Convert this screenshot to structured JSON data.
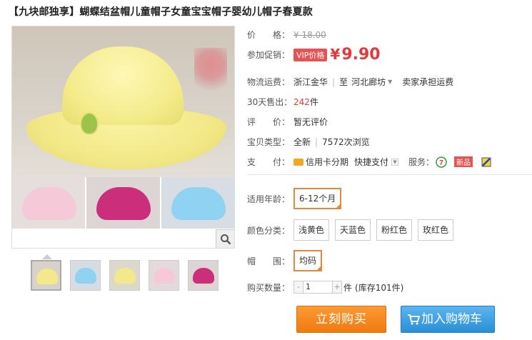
{
  "title": "【九块邮独享】蝴蝶结盆帽儿童帽子女童宝宝帽子婴幼儿帽子春夏款",
  "price": {
    "label": "价　　格：",
    "original": "¥ 18.00"
  },
  "promo": {
    "label": "参加促销：",
    "tag": "VIP价格",
    "yen": "¥",
    "value": "9.90"
  },
  "shipping": {
    "label": "物流运费：",
    "from": "浙江金华",
    "sep": "|",
    "to_prefix": "至",
    "to": "河北廊坊",
    "note": "卖家承担运费"
  },
  "sales": {
    "label": "30天售出：",
    "count": "242",
    "unit": "件"
  },
  "review": {
    "label": "评　　价：",
    "value": "暂无评价"
  },
  "type": {
    "label": "宝贝类型：",
    "value": "全新",
    "views": "7572次浏览"
  },
  "payment": {
    "label": "支　　付：",
    "credit": "信用卡分期",
    "quick": "快捷支付",
    "service_label": "服务：",
    "badge": "新品"
  },
  "age": {
    "label": "适用年龄：",
    "options": [
      "6-12个月"
    ]
  },
  "color": {
    "label": "颜色分类：",
    "options": [
      "浅黄色",
      "天蓝色",
      "粉红色",
      "玫红色"
    ]
  },
  "size": {
    "label": "帽　　围：",
    "options": [
      "均码"
    ]
  },
  "quantity": {
    "label": "购买数量：",
    "minus": "-",
    "value": "1",
    "plus": "+",
    "unit": "件",
    "stock": "(库存101件)"
  },
  "buttons": {
    "buy": "立刻购买",
    "cart": "加入购物车"
  },
  "colors": {
    "accent": "#e4393c",
    "buy": "#f07a10",
    "cart": "#2a8fd4",
    "selected_border": "#e4893a"
  }
}
